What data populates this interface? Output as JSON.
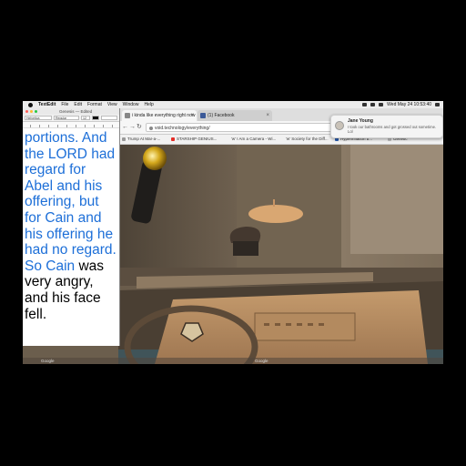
{
  "menubar": {
    "app": "TextEdit",
    "items": [
      "File",
      "Edit",
      "Format",
      "View",
      "Window",
      "Help"
    ],
    "clock": "Wed May 24  10:53:40"
  },
  "textedit": {
    "title": "Genesis — Edited",
    "font_family_value": "Helvetica",
    "font_style_value": "Regular",
    "font_size_value": "12",
    "body": {
      "blue": "portions. And the LORD had regard for Abel and his offering, but for Cain and his offering he had no regard. So Cain",
      "black": "was very angry, and his face fell."
    }
  },
  "browser": {
    "tabs": [
      {
        "label": "i kinda like everything right now",
        "active": true
      },
      {
        "label": "(1) Facebook",
        "active": false
      }
    ],
    "url": "void.technology/everything/",
    "bookmarks": [
      "Trump At Mar-a-...",
      "STARSHIP GENIUS...",
      "'w' I Am a Camera - Wi...",
      "'w' Society for the Diff...",
      "Hyperinflation b...",
      "Genetic"
    ]
  },
  "notification": {
    "sender": "Jane Young",
    "message": "I took our bathrooms and got grossed out sometime. Lol"
  },
  "dock": {
    "left_label": "Google",
    "right_label": "Google"
  },
  "colors": {
    "text_blue": "#1d6fd8",
    "facebook_blue": "#3b5998",
    "youtube_red": "#e52d27"
  }
}
